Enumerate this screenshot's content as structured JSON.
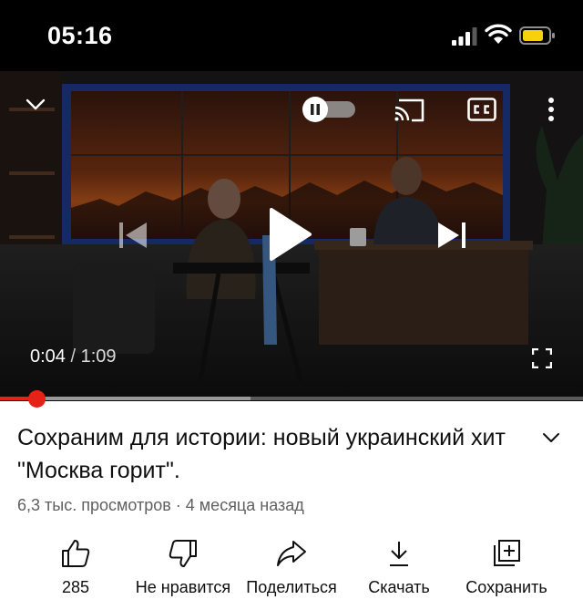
{
  "status_bar": {
    "time": "05:16"
  },
  "player": {
    "current_time": "0:04",
    "separator": " / ",
    "duration": "1:09",
    "progress_fraction": 0.064,
    "buffered_fraction": 0.43,
    "icons": [
      "collapse-chevron-icon",
      "autoplay-toggle",
      "cast-icon",
      "captions-icon",
      "more-vert-icon",
      "previous-icon",
      "play-icon",
      "next-icon",
      "fullscreen-icon"
    ]
  },
  "video": {
    "title": "Сохраним для истории: новый украинский хит \"Москва горит\".",
    "meta": "6,3 тыс. просмотров · 4 месяца назад"
  },
  "actions": [
    {
      "label": "285",
      "icon": "thumbs-up-icon"
    },
    {
      "label": "Не нравится",
      "icon": "thumbs-down-icon"
    },
    {
      "label": "Поделиться",
      "icon": "share-icon"
    },
    {
      "label": "Скачать",
      "icon": "download-icon"
    },
    {
      "label": "Сохранить",
      "icon": "save-playlist-icon"
    }
  ],
  "colors": {
    "accent": "#e62117",
    "text": "#0f0f0f",
    "secondary_text": "#606060"
  }
}
